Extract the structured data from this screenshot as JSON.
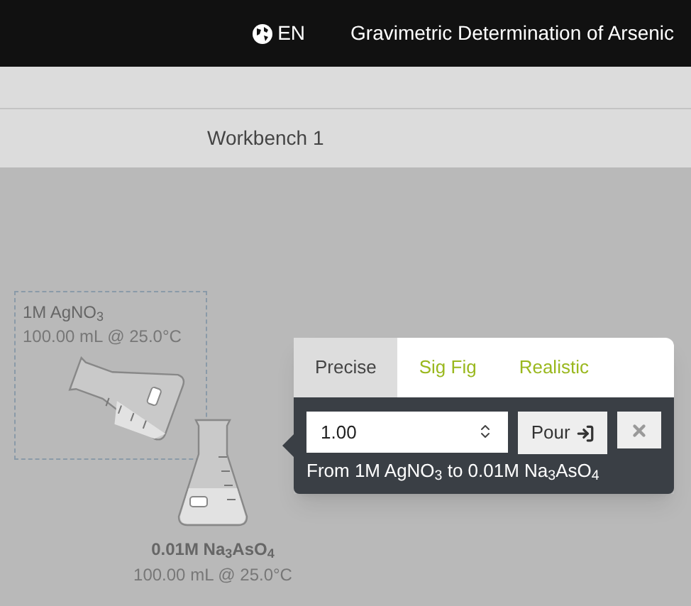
{
  "header": {
    "language": "EN",
    "title": "Gravimetric Determination of Arsenic"
  },
  "workbench": {
    "label": "Workbench 1"
  },
  "flasks": [
    {
      "kind": "tilted",
      "name": "1M AgNO$_{3}$",
      "volume": "100.00 mL @ 25.0°C",
      "selected": true
    },
    {
      "kind": "upright",
      "name": "0.01M Na$_{3}$AsO$_{4}$",
      "volume": "100.00 mL @ 25.0°C",
      "selected": false
    }
  ],
  "pour_popover": {
    "tabs": [
      {
        "label": "Precise",
        "selected": true
      },
      {
        "label": "Sig Fig",
        "selected": false
      },
      {
        "label": "Realistic",
        "selected": false
      }
    ],
    "amount": "1.00",
    "pour_button": "Pour",
    "description": "From 1M AgNO$_{3}$ to 0.01M Na$_{3}$AsO$_{4}$"
  }
}
